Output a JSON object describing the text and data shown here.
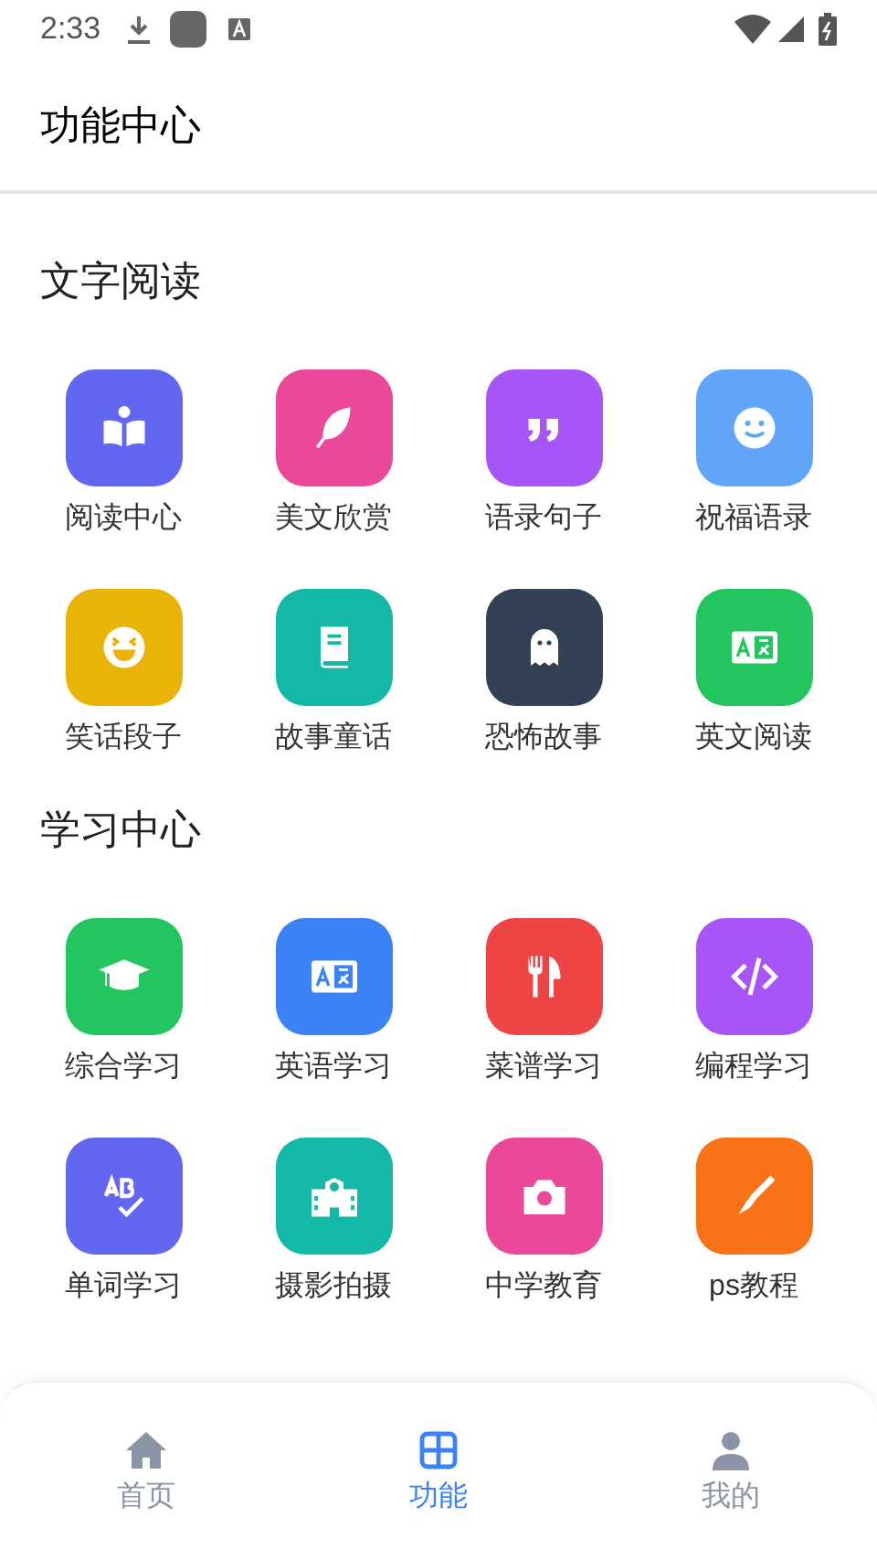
{
  "status_bar": {
    "time": "2:33"
  },
  "header": {
    "title": "功能中心"
  },
  "sections": [
    {
      "title": "文字阅读",
      "items": [
        {
          "label": "阅读中心",
          "color": "#6366f1"
        },
        {
          "label": "美文欣赏",
          "color": "#ec4899"
        },
        {
          "label": "语录句子",
          "color": "#a855f7"
        },
        {
          "label": "祝福语录",
          "color": "#60a5fa"
        },
        {
          "label": "笑话段子",
          "color": "#eab308"
        },
        {
          "label": "故事童话",
          "color": "#14b8a6"
        },
        {
          "label": "恐怖故事",
          "color": "#334155"
        },
        {
          "label": "英文阅读",
          "color": "#22c55e"
        }
      ]
    },
    {
      "title": "学习中心",
      "items": [
        {
          "label": "综合学习",
          "color": "#22c55e"
        },
        {
          "label": "英语学习",
          "color": "#3b82f6"
        },
        {
          "label": "菜谱学习",
          "color": "#ef4444"
        },
        {
          "label": "编程学习",
          "color": "#a855f7"
        },
        {
          "label": "单词学习",
          "color": "#6366f1"
        },
        {
          "label": "摄影拍摄",
          "color": "#14b8a6"
        },
        {
          "label": "中学教育",
          "color": "#ec4899"
        },
        {
          "label": "ps教程",
          "color": "#f97316"
        }
      ]
    }
  ],
  "bottom_nav": [
    {
      "label": "首页",
      "selected": false
    },
    {
      "label": "功能",
      "selected": true
    },
    {
      "label": "我的",
      "selected": false
    }
  ]
}
